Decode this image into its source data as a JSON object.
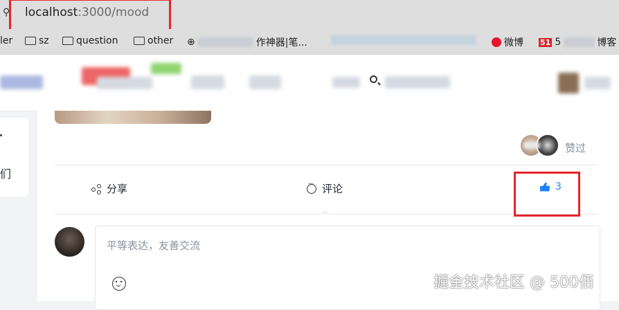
{
  "browser": {
    "url_host": "localhost",
    "url_path": ":3000/mood",
    "site_info_icon": "site-info-icon",
    "annotation_color": "#e5252a"
  },
  "bookmarks": [
    {
      "label": "ler",
      "icon": "none"
    },
    {
      "label": "sz",
      "icon": "folder-icon"
    },
    {
      "label": "question",
      "icon": "folder-icon"
    },
    {
      "label": "other",
      "icon": "folder-icon"
    },
    {
      "label": "作神器|笔...",
      "icon": "globe-icon"
    },
    {
      "label": "微博",
      "icon": "weibo-icon"
    },
    {
      "label": "51",
      "icon": "51cto-icon"
    },
    {
      "label": "5",
      "icon": "none"
    },
    {
      "label": "博客",
      "icon": "none"
    }
  ],
  "leftcard": {
    "text": "们"
  },
  "post": {
    "liked_label": "赞过",
    "actions": {
      "share": "分享",
      "comment": "评论",
      "like_count": "3"
    },
    "like_color": "#1e80ff"
  },
  "comment": {
    "placeholder": "平等表达，友善交流",
    "emoji_icon": "smile-icon"
  },
  "watermark": "掘金技术社区 @ 500佰"
}
